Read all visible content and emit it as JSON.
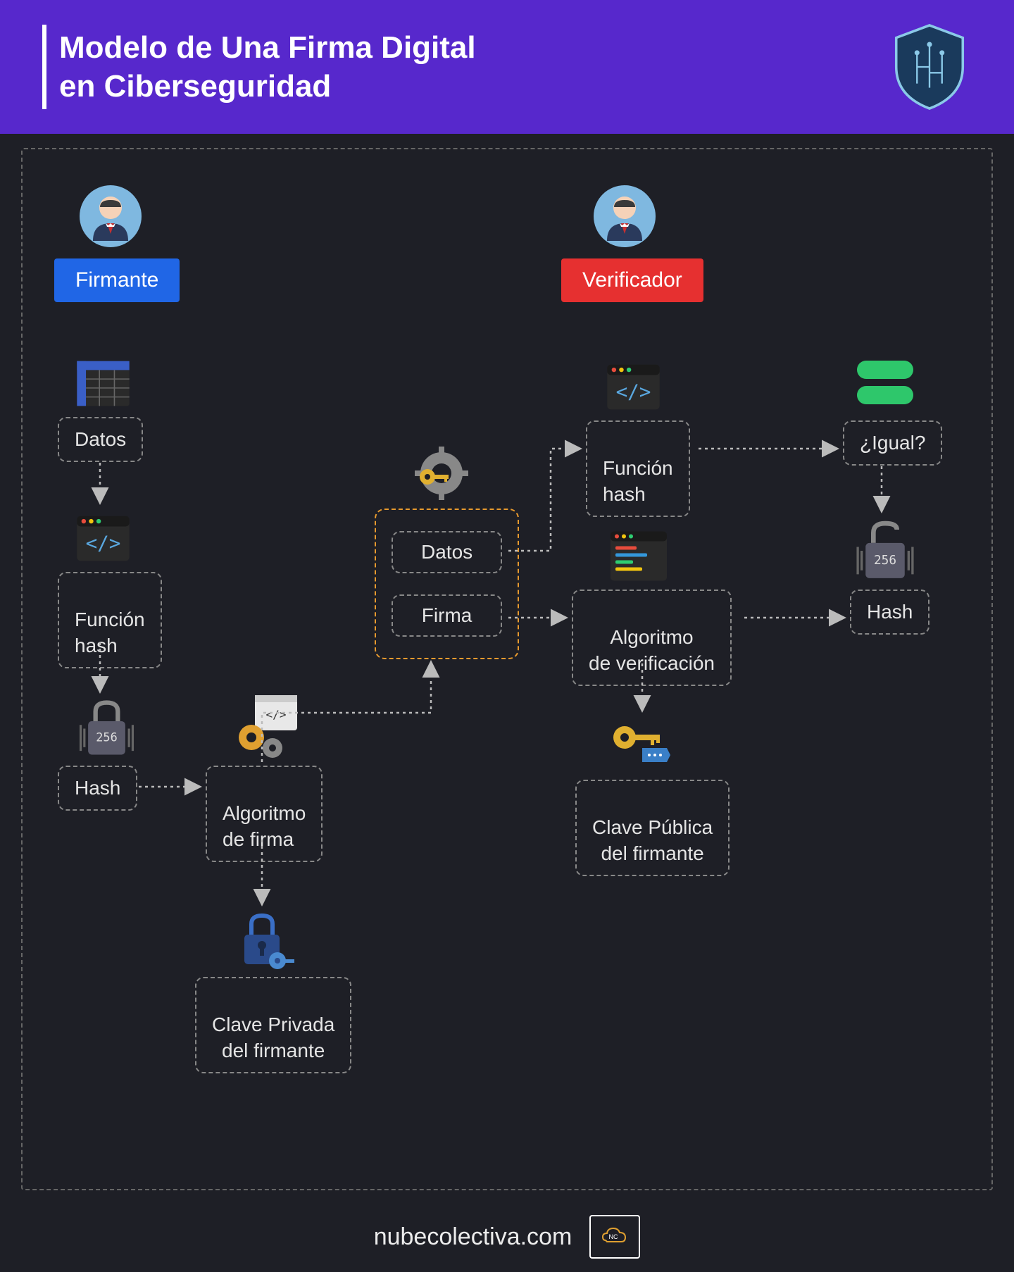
{
  "header": {
    "title_line1": "Modelo de Una Firma Digital",
    "title_line2": "en Ciberseguridad"
  },
  "roles": {
    "signer": "Firmante",
    "verifier": "Verificador"
  },
  "nodes": {
    "datos": "Datos",
    "funcion_hash": "Función\nhash",
    "hash": "Hash",
    "algoritmo_firma": "Algoritmo\nde firma",
    "clave_privada": "Clave Privada\ndel firmante",
    "package_datos": "Datos",
    "package_firma": "Firma",
    "funcion_hash_v": "Función\nhash",
    "algoritmo_verif": "Algoritmo\nde verificación",
    "clave_publica": "Clave Pública\ndel firmante",
    "igual": "¿Igual?",
    "hash_v": "Hash"
  },
  "footer": {
    "url": "nubecolectiva.com",
    "logo_text": "NC"
  },
  "icons": {
    "shield": "shield-icon",
    "avatar": "avatar-icon",
    "spreadsheet": "spreadsheet-icon",
    "code": "code-icon",
    "lock256": "lock-256-icon",
    "gears_code": "gears-code-icon",
    "lock_key": "lock-key-icon",
    "gear_key": "gear-key-icon",
    "code_window": "code-window-icon",
    "key_tag": "key-tag-icon",
    "equals": "equals-icon",
    "open_lock256": "open-lock-256-icon"
  },
  "colors": {
    "header_bg": "#5728cc",
    "signer_bg": "#2066e6",
    "verifier_bg": "#e63030",
    "package_border": "#e89a2e",
    "equals_green": "#2ec76b"
  }
}
